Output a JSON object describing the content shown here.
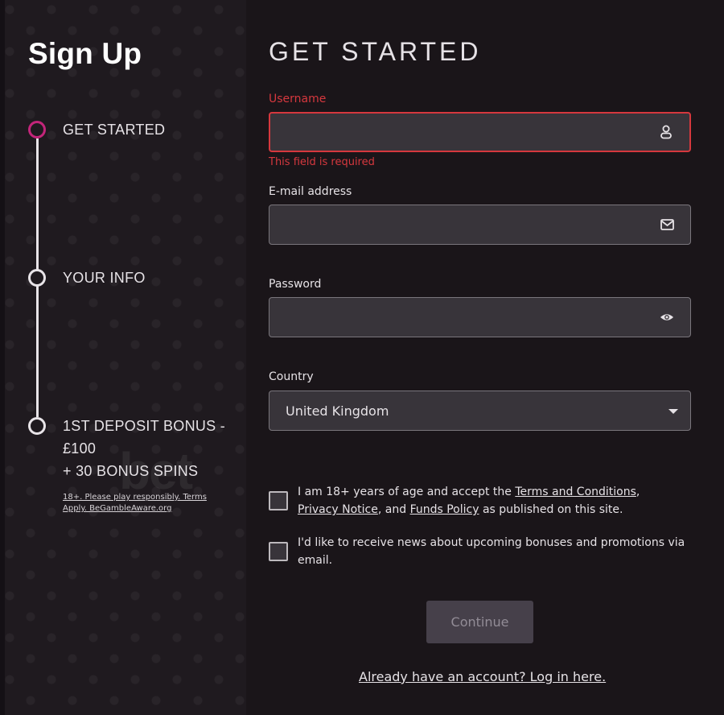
{
  "sidebar": {
    "title": "Sign Up",
    "steps": [
      {
        "label": "GET STARTED",
        "active": true
      },
      {
        "label": "YOUR INFO",
        "active": false
      },
      {
        "label_lines": [
          "1ST DEPOSIT BONUS -",
          "£100",
          "+ 30 BONUS SPINS"
        ],
        "active": false
      }
    ],
    "watermark": "bet",
    "disclaimer": {
      "part1": "18+. Please play responsibly. Terms",
      "part2": "Apply. BeGambleAware.org"
    }
  },
  "form": {
    "title": "GET STARTED",
    "username": {
      "label": "Username",
      "value": "",
      "placeholder": "",
      "error": "This field is required",
      "icon": "user-icon"
    },
    "email": {
      "label": "E-mail address",
      "value": "",
      "placeholder": "",
      "icon": "envelope-icon"
    },
    "password": {
      "label": "Password",
      "value": "",
      "placeholder": "",
      "icon": "eye-icon"
    },
    "country": {
      "label": "Country",
      "selected": "United Kingdom"
    },
    "age_consent": {
      "checked": false,
      "text_before": "I am 18+ years of age and accept the ",
      "terms_link": "Terms and Conditions",
      "comma": ",",
      "privacy_link": "Privacy Notice",
      "and_text": ", and ",
      "funds_link": "Funds Policy",
      "text_after": " as published on this site."
    },
    "marketing_consent": {
      "checked": false,
      "text": "I'd like to receive news about upcoming bonuses and promotions via email."
    },
    "continue_label": "Continue",
    "login_link": "Already have an account? Log in here."
  },
  "colors": {
    "active_step": "#c3257a",
    "error": "#d6383e",
    "background": "#1a1519",
    "input_bg": "#38343a"
  }
}
